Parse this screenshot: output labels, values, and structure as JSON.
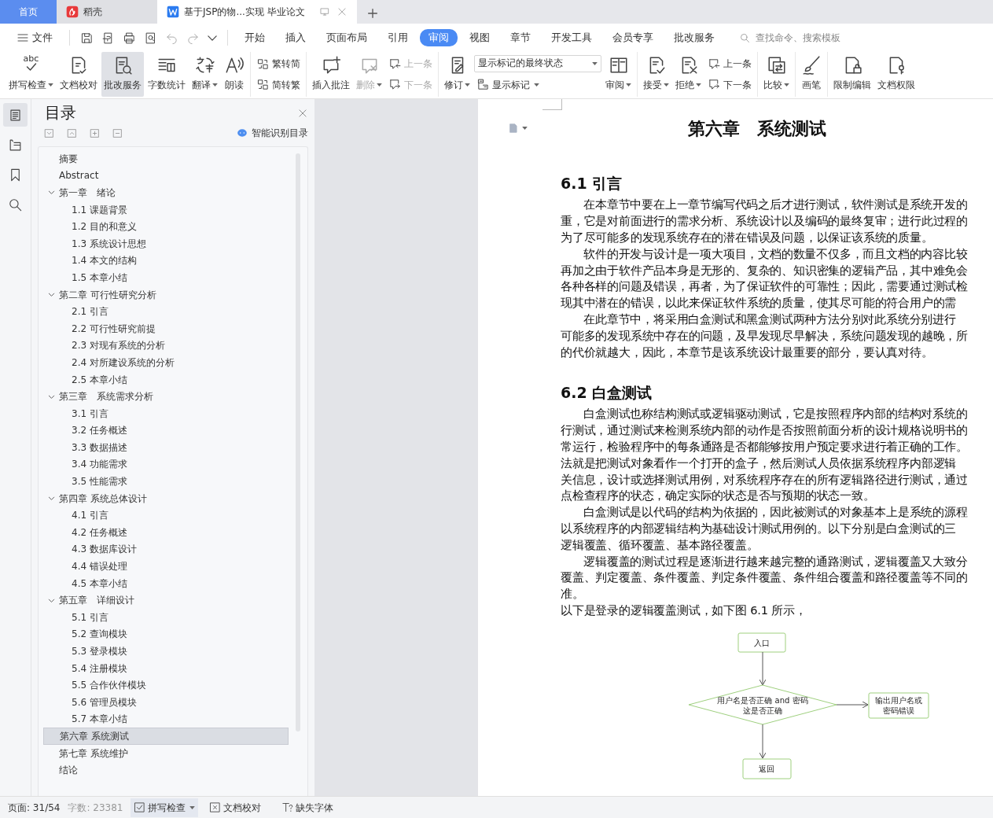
{
  "window_tabs": [
    {
      "kind": "home",
      "label": "首页",
      "selected": false
    },
    {
      "kind": "docer",
      "label": "稻壳",
      "selected": false
    },
    {
      "kind": "document",
      "label": "基于JSP的物...实现 毕业论文",
      "selected": true
    }
  ],
  "menu": {
    "file_label": "文件",
    "tabs": [
      {
        "label": "开始",
        "selected": false
      },
      {
        "label": "插入",
        "selected": false
      },
      {
        "label": "页面布局",
        "selected": false
      },
      {
        "label": "引用",
        "selected": false
      },
      {
        "label": "审阅",
        "selected": true
      },
      {
        "label": "视图",
        "selected": false
      },
      {
        "label": "章节",
        "selected": false
      },
      {
        "label": "开发工具",
        "selected": false
      },
      {
        "label": "会员专享",
        "selected": false
      },
      {
        "label": "批改服务",
        "selected": false
      }
    ],
    "search": {
      "placeholder": "查找命令、搜索模板"
    }
  },
  "ribbon": [
    {
      "items": [
        {
          "kind": "large",
          "label": "拼写检查",
          "icon_text": "abc",
          "dropdown": true,
          "disabled": false,
          "pressed": false
        },
        {
          "kind": "large",
          "label": "文档校对",
          "dropdown": false,
          "disabled": false,
          "pressed": false
        },
        {
          "kind": "large",
          "label": "批改服务",
          "dropdown": false,
          "disabled": false,
          "pressed": true
        },
        {
          "kind": "large",
          "label": "字数统计",
          "dropdown": false,
          "disabled": false,
          "pressed": false
        },
        {
          "kind": "large",
          "label": "翻译",
          "dropdown": true,
          "disabled": false,
          "pressed": false
        },
        {
          "kind": "large",
          "label": "朗读",
          "dropdown": false,
          "disabled": false,
          "pressed": false
        }
      ]
    },
    {
      "items": [
        {
          "kind": "stack",
          "items": [
            {
              "kind": "small",
              "label": "繁转简",
              "dropdown": false,
              "disabled": false
            },
            {
              "kind": "small",
              "label": "简转繁",
              "dropdown": false,
              "disabled": false
            }
          ]
        }
      ]
    },
    {
      "items": [
        {
          "kind": "large",
          "label": "插入批注",
          "dropdown": false,
          "disabled": false,
          "pressed": false
        },
        {
          "kind": "large",
          "label": "删除",
          "dropdown": true,
          "disabled": true,
          "pressed": false
        },
        {
          "kind": "stack",
          "items": [
            {
              "kind": "small",
              "label": "上一条",
              "dropdown": false,
              "disabled": true
            },
            {
              "kind": "small",
              "label": "下一条",
              "dropdown": false,
              "disabled": true
            }
          ]
        }
      ]
    },
    {
      "items": [
        {
          "kind": "large",
          "label": "修订",
          "dropdown": true,
          "disabled": false,
          "pressed": false
        },
        {
          "kind": "stack",
          "items": [
            {
              "kind": "select",
              "value": "显示标记的最终状态"
            },
            {
              "kind": "small",
              "label": "显示标记",
              "dropdown": true,
              "disabled": false
            }
          ]
        },
        {
          "kind": "large",
          "label": "审阅",
          "dropdown": true,
          "disabled": false,
          "pressed": false
        }
      ]
    },
    {
      "items": [
        {
          "kind": "large",
          "label": "接受",
          "dropdown": true,
          "disabled": false,
          "pressed": false
        },
        {
          "kind": "large",
          "label": "拒绝",
          "dropdown": true,
          "disabled": false,
          "pressed": false
        },
        {
          "kind": "stack",
          "items": [
            {
              "kind": "small",
              "label": "上一条",
              "dropdown": false,
              "disabled": false
            },
            {
              "kind": "small",
              "label": "下一条",
              "dropdown": false,
              "disabled": false
            }
          ]
        }
      ]
    },
    {
      "items": [
        {
          "kind": "large",
          "label": "比较",
          "dropdown": true,
          "disabled": false,
          "pressed": false
        }
      ]
    },
    {
      "items": [
        {
          "kind": "large",
          "label": "画笔",
          "dropdown": false,
          "disabled": false,
          "pressed": false
        }
      ]
    },
    {
      "items": [
        {
          "kind": "large",
          "label": "限制编辑",
          "dropdown": false,
          "disabled": false,
          "pressed": false
        },
        {
          "kind": "large",
          "label": "文档权限",
          "dropdown": false,
          "disabled": false,
          "pressed": false
        }
      ]
    }
  ],
  "side_rail": [
    {
      "selected": true
    },
    {
      "selected": false
    },
    {
      "selected": false
    },
    {
      "selected": false
    }
  ],
  "toc_panel": {
    "title": "目录",
    "smart_label": "智能识别目录",
    "items": [
      {
        "label": "摘要",
        "selected": false
      },
      {
        "label": "Abstract",
        "selected": false
      },
      {
        "label": "第一章　绪论",
        "selected": false,
        "expanded": true,
        "children": [
          {
            "label": "1.1 课题背景",
            "selected": false
          },
          {
            "label": "1.2 目的和意义",
            "selected": false
          },
          {
            "label": "1.3 系统设计思想",
            "selected": false
          },
          {
            "label": "1.4 本文的结构",
            "selected": false
          },
          {
            "label": "1.5 本章小结",
            "selected": false
          }
        ]
      },
      {
        "label": "第二章 可行性研究分析",
        "selected": false,
        "expanded": true,
        "children": [
          {
            "label": "2.1 引言",
            "selected": false
          },
          {
            "label": "2.2 可行性研究前提",
            "selected": false
          },
          {
            "label": "2.3 对现有系统的分析",
            "selected": false
          },
          {
            "label": "2.4 对所建设系统的分析",
            "selected": false
          },
          {
            "label": "2.5 本章小结",
            "selected": false
          }
        ]
      },
      {
        "label": "第三章　系统需求分析",
        "selected": false,
        "expanded": true,
        "children": [
          {
            "label": "3.1 引言",
            "selected": false
          },
          {
            "label": "3.2 任务概述",
            "selected": false
          },
          {
            "label": "3.3 数据描述",
            "selected": false
          },
          {
            "label": "3.4 功能需求",
            "selected": false
          },
          {
            "label": "3.5 性能需求",
            "selected": false
          }
        ]
      },
      {
        "label": "第四章 系统总体设计",
        "selected": false,
        "expanded": true,
        "children": [
          {
            "label": "4.1 引言",
            "selected": false
          },
          {
            "label": "4.2 任务概述",
            "selected": false
          },
          {
            "label": "4.3 数据库设计",
            "selected": false
          },
          {
            "label": "4.4 错误处理",
            "selected": false
          },
          {
            "label": "4.5 本章小结",
            "selected": false
          }
        ]
      },
      {
        "label": "第五章　详细设计",
        "selected": false,
        "expanded": true,
        "children": [
          {
            "label": "5.1 引言",
            "selected": false
          },
          {
            "label": "5.2 查询模块",
            "selected": false
          },
          {
            "label": "5.3 登录模块",
            "selected": false
          },
          {
            "label": "5.4 注册模块",
            "selected": false
          },
          {
            "label": "5.5 合作伙伴模块",
            "selected": false
          },
          {
            "label": "5.6 管理员模块",
            "selected": false
          },
          {
            "label": "5.7 本章小结",
            "selected": false
          }
        ]
      },
      {
        "label": "第六章 系统测试",
        "selected": true
      },
      {
        "label": "第七章 系统维护",
        "selected": false
      },
      {
        "label": "结论",
        "selected": false
      }
    ]
  },
  "document": {
    "chapter_title": "第六章　系统测试",
    "sections": [
      {
        "heading": "6.1 引言",
        "paragraphs": [
          {
            "indent": true,
            "lines": [
              "在本章节中要在上一章节编写代码之后才进行测试，软件测试是系统开发的",
              "重，它是对前面进行的需求分析、系统设计以及编码的最终复审；进行此过程的",
              "为了尽可能多的发现系统存在的潜在错误及问题，以保证该系统的质量。"
            ]
          },
          {
            "indent": true,
            "lines": [
              "软件的开发与设计是一项大项目，文档的数量不仅多，而且文档的内容比较",
              "再加之由于软件产品本身是无形的、复杂的、知识密集的逻辑产品，其中难免会",
              "各种各样的问题及错误，再者，为了保证软件的可靠性；因此，需要通过测试检",
              "现其中潜在的错误，以此来保证软件系统的质量，使其尽可能的符合用户的需"
            ]
          },
          {
            "indent": true,
            "lines": [
              "在此章节中，将采用白盒测试和黑盒测试两种方法分别对此系统分别进行",
              "可能多的发现系统中存在的问题，及早发现尽早解决，系统问题发现的越晚，所",
              "的代价就越大，因此，本章节是该系统设计最重要的部分，要认真对待。"
            ]
          }
        ]
      },
      {
        "heading": "6.2 白盒测试",
        "paragraphs": [
          {
            "indent": true,
            "lines": [
              "白盒测试也称结构测试或逻辑驱动测试，它是按照程序内部的结构对系统的",
              "行测试，通过测试来检测系统内部的动作是否按照前面分析的设计规格说明书的",
              "常运行，检验程序中的每条通路是否都能够按用户预定要求进行着正确的工作。",
              "法就是把测试对象看作一个打开的盒子，然后测试人员依据系统程序内部逻辑",
              "关信息，设计或选择测试用例，对系统程序存在的所有逻辑路径进行测试，通过",
              "点检查程序的状态，确定实际的状态是否与预期的状态一致。"
            ]
          },
          {
            "indent": true,
            "lines": [
              "白盒测试是以代码的结构为依据的，因此被测试的对象基本上是系统的源程",
              "以系统程序的内部逻辑结构为基础设计测试用例的。以下分别是白盒测试的三",
              "逻辑覆盖、循环覆盖、基本路径覆盖。"
            ]
          },
          {
            "indent": true,
            "lines": [
              "逻辑覆盖的测试过程是逐渐进行越来越完整的通路测试，逻辑覆盖又大致分",
              "覆盖、判定覆盖、条件覆盖、判定条件覆盖、条件组合覆盖和路径覆盖等不同的",
              "准。"
            ]
          },
          {
            "indent": false,
            "lines": [
              "以下是登录的逻辑覆盖测试，如下图 6.1 所示，"
            ]
          }
        ]
      }
    ],
    "flowchart": {
      "entry": "入口",
      "decision": [
        "用户名是否正确 and 密码",
        "这是否正确"
      ],
      "error": [
        "输出用户名或",
        "密码错误"
      ],
      "return": "返回"
    }
  },
  "status_bar": {
    "page": "页面: 31/54",
    "word_count": "字数: 23381",
    "spell_check": "拼写检查",
    "proofread": "文档校对",
    "missing_fonts": "缺失字体"
  }
}
